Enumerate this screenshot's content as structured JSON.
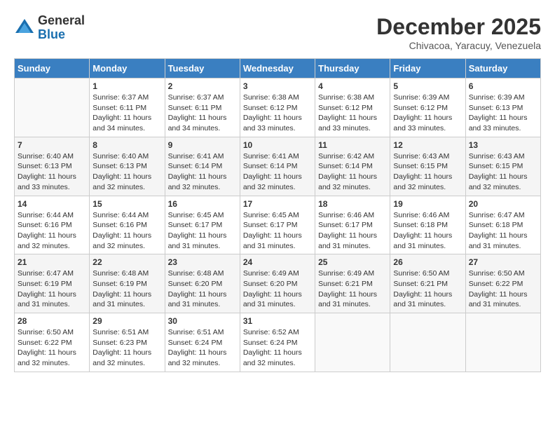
{
  "header": {
    "logo_general": "General",
    "logo_blue": "Blue",
    "month_title": "December 2025",
    "location": "Chivacoa, Yaracuy, Venezuela"
  },
  "weekdays": [
    "Sunday",
    "Monday",
    "Tuesday",
    "Wednesday",
    "Thursday",
    "Friday",
    "Saturday"
  ],
  "weeks": [
    [
      {
        "day": "",
        "sunrise": "",
        "sunset": "",
        "daylight": ""
      },
      {
        "day": "1",
        "sunrise": "Sunrise: 6:37 AM",
        "sunset": "Sunset: 6:11 PM",
        "daylight": "Daylight: 11 hours and 34 minutes."
      },
      {
        "day": "2",
        "sunrise": "Sunrise: 6:37 AM",
        "sunset": "Sunset: 6:11 PM",
        "daylight": "Daylight: 11 hours and 34 minutes."
      },
      {
        "day": "3",
        "sunrise": "Sunrise: 6:38 AM",
        "sunset": "Sunset: 6:12 PM",
        "daylight": "Daylight: 11 hours and 33 minutes."
      },
      {
        "day": "4",
        "sunrise": "Sunrise: 6:38 AM",
        "sunset": "Sunset: 6:12 PM",
        "daylight": "Daylight: 11 hours and 33 minutes."
      },
      {
        "day": "5",
        "sunrise": "Sunrise: 6:39 AM",
        "sunset": "Sunset: 6:12 PM",
        "daylight": "Daylight: 11 hours and 33 minutes."
      },
      {
        "day": "6",
        "sunrise": "Sunrise: 6:39 AM",
        "sunset": "Sunset: 6:13 PM",
        "daylight": "Daylight: 11 hours and 33 minutes."
      }
    ],
    [
      {
        "day": "7",
        "sunrise": "Sunrise: 6:40 AM",
        "sunset": "Sunset: 6:13 PM",
        "daylight": "Daylight: 11 hours and 33 minutes."
      },
      {
        "day": "8",
        "sunrise": "Sunrise: 6:40 AM",
        "sunset": "Sunset: 6:13 PM",
        "daylight": "Daylight: 11 hours and 32 minutes."
      },
      {
        "day": "9",
        "sunrise": "Sunrise: 6:41 AM",
        "sunset": "Sunset: 6:14 PM",
        "daylight": "Daylight: 11 hours and 32 minutes."
      },
      {
        "day": "10",
        "sunrise": "Sunrise: 6:41 AM",
        "sunset": "Sunset: 6:14 PM",
        "daylight": "Daylight: 11 hours and 32 minutes."
      },
      {
        "day": "11",
        "sunrise": "Sunrise: 6:42 AM",
        "sunset": "Sunset: 6:14 PM",
        "daylight": "Daylight: 11 hours and 32 minutes."
      },
      {
        "day": "12",
        "sunrise": "Sunrise: 6:43 AM",
        "sunset": "Sunset: 6:15 PM",
        "daylight": "Daylight: 11 hours and 32 minutes."
      },
      {
        "day": "13",
        "sunrise": "Sunrise: 6:43 AM",
        "sunset": "Sunset: 6:15 PM",
        "daylight": "Daylight: 11 hours and 32 minutes."
      }
    ],
    [
      {
        "day": "14",
        "sunrise": "Sunrise: 6:44 AM",
        "sunset": "Sunset: 6:16 PM",
        "daylight": "Daylight: 11 hours and 32 minutes."
      },
      {
        "day": "15",
        "sunrise": "Sunrise: 6:44 AM",
        "sunset": "Sunset: 6:16 PM",
        "daylight": "Daylight: 11 hours and 32 minutes."
      },
      {
        "day": "16",
        "sunrise": "Sunrise: 6:45 AM",
        "sunset": "Sunset: 6:17 PM",
        "daylight": "Daylight: 11 hours and 31 minutes."
      },
      {
        "day": "17",
        "sunrise": "Sunrise: 6:45 AM",
        "sunset": "Sunset: 6:17 PM",
        "daylight": "Daylight: 11 hours and 31 minutes."
      },
      {
        "day": "18",
        "sunrise": "Sunrise: 6:46 AM",
        "sunset": "Sunset: 6:17 PM",
        "daylight": "Daylight: 11 hours and 31 minutes."
      },
      {
        "day": "19",
        "sunrise": "Sunrise: 6:46 AM",
        "sunset": "Sunset: 6:18 PM",
        "daylight": "Daylight: 11 hours and 31 minutes."
      },
      {
        "day": "20",
        "sunrise": "Sunrise: 6:47 AM",
        "sunset": "Sunset: 6:18 PM",
        "daylight": "Daylight: 11 hours and 31 minutes."
      }
    ],
    [
      {
        "day": "21",
        "sunrise": "Sunrise: 6:47 AM",
        "sunset": "Sunset: 6:19 PM",
        "daylight": "Daylight: 11 hours and 31 minutes."
      },
      {
        "day": "22",
        "sunrise": "Sunrise: 6:48 AM",
        "sunset": "Sunset: 6:19 PM",
        "daylight": "Daylight: 11 hours and 31 minutes."
      },
      {
        "day": "23",
        "sunrise": "Sunrise: 6:48 AM",
        "sunset": "Sunset: 6:20 PM",
        "daylight": "Daylight: 11 hours and 31 minutes."
      },
      {
        "day": "24",
        "sunrise": "Sunrise: 6:49 AM",
        "sunset": "Sunset: 6:20 PM",
        "daylight": "Daylight: 11 hours and 31 minutes."
      },
      {
        "day": "25",
        "sunrise": "Sunrise: 6:49 AM",
        "sunset": "Sunset: 6:21 PM",
        "daylight": "Daylight: 11 hours and 31 minutes."
      },
      {
        "day": "26",
        "sunrise": "Sunrise: 6:50 AM",
        "sunset": "Sunset: 6:21 PM",
        "daylight": "Daylight: 11 hours and 31 minutes."
      },
      {
        "day": "27",
        "sunrise": "Sunrise: 6:50 AM",
        "sunset": "Sunset: 6:22 PM",
        "daylight": "Daylight: 11 hours and 31 minutes."
      }
    ],
    [
      {
        "day": "28",
        "sunrise": "Sunrise: 6:50 AM",
        "sunset": "Sunset: 6:22 PM",
        "daylight": "Daylight: 11 hours and 32 minutes."
      },
      {
        "day": "29",
        "sunrise": "Sunrise: 6:51 AM",
        "sunset": "Sunset: 6:23 PM",
        "daylight": "Daylight: 11 hours and 32 minutes."
      },
      {
        "day": "30",
        "sunrise": "Sunrise: 6:51 AM",
        "sunset": "Sunset: 6:24 PM",
        "daylight": "Daylight: 11 hours and 32 minutes."
      },
      {
        "day": "31",
        "sunrise": "Sunrise: 6:52 AM",
        "sunset": "Sunset: 6:24 PM",
        "daylight": "Daylight: 11 hours and 32 minutes."
      },
      {
        "day": "",
        "sunrise": "",
        "sunset": "",
        "daylight": ""
      },
      {
        "day": "",
        "sunrise": "",
        "sunset": "",
        "daylight": ""
      },
      {
        "day": "",
        "sunrise": "",
        "sunset": "",
        "daylight": ""
      }
    ]
  ]
}
